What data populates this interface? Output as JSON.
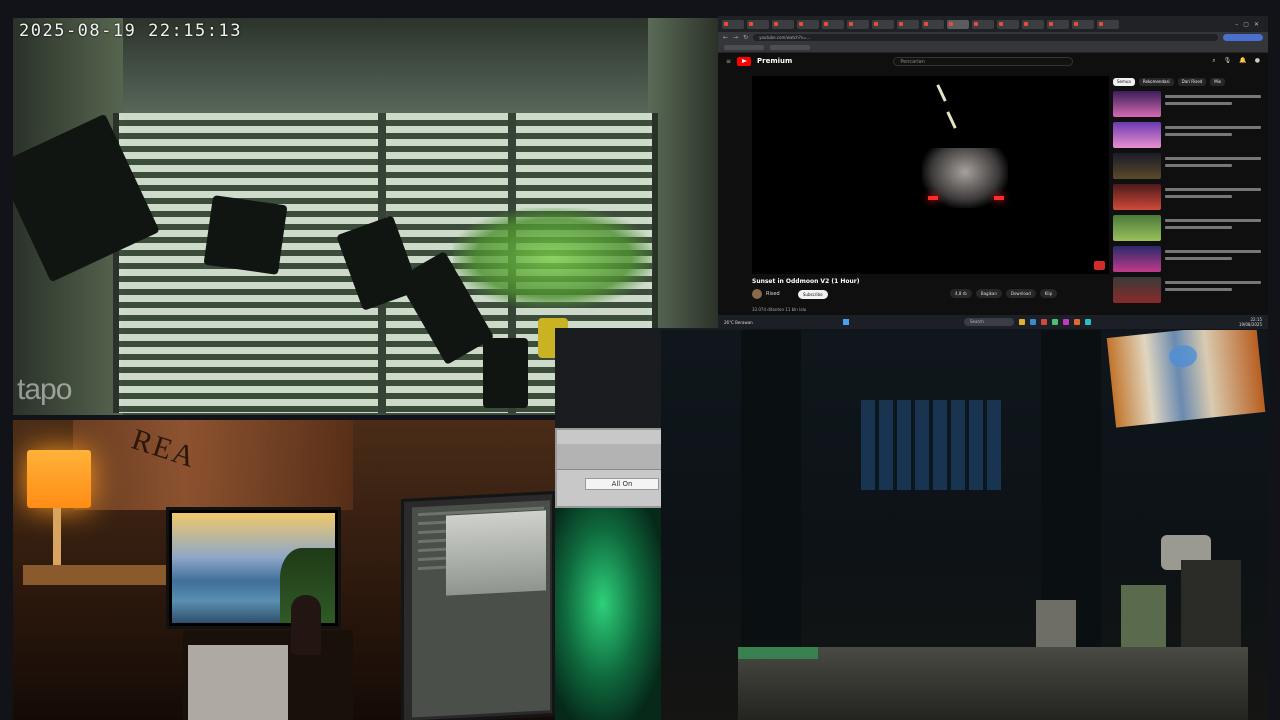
{
  "camera": {
    "timestamp": "2025-08-19 22:15:13",
    "brand_watermark": "tapo"
  },
  "browser": {
    "url": "youtube.com/watch?v=…",
    "yt_logo_text": "Premium",
    "search_placeholder": "Pencarian",
    "video_title": "Sunset in Oddmoon V2 (1 Hour)",
    "channel_name": "Rised",
    "subscribe_label": "Subscribe",
    "actions": [
      "4,8 rb",
      "Bagikan",
      "Download",
      "Klip"
    ],
    "description": "33.074 ditonton  11 bln lalu",
    "chips": [
      "Semua",
      "Rekomendasi",
      "Dari Rised",
      "Mix"
    ],
    "taskbar": {
      "weather": "26°C Berawan",
      "search_label": "Search",
      "time": "22:15",
      "date": "19/08/2025"
    }
  },
  "dialog": {
    "button_label": "All On"
  },
  "room": {
    "poster_text": "REA"
  },
  "colors": {
    "youtube_red": "#ff0000",
    "lamp_orange": "#ff9a20",
    "green_light": "#2ed07a"
  }
}
